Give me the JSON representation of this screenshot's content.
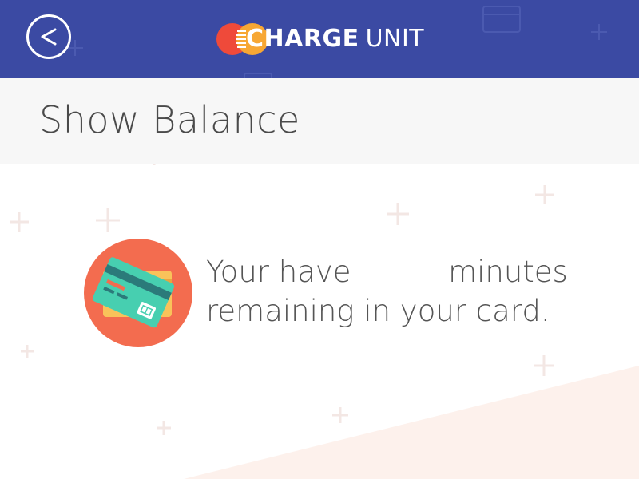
{
  "header": {
    "back_label": "<",
    "logo": {
      "strong": "CHARGE",
      "light": "UNIT"
    },
    "background_color": "#3b4aa3"
  },
  "page": {
    "title": "Show Balance"
  },
  "balance": {
    "prefix": "Your have",
    "minutes_value": "",
    "suffix": "minutes",
    "line2": "remaining in your card.",
    "icon": "credit-card-icon"
  },
  "colors": {
    "accent_orange": "#f36c4f",
    "card_teal": "#47cfb0",
    "card_yellow": "#f9c25a",
    "title_band": "#f7f7f7"
  }
}
